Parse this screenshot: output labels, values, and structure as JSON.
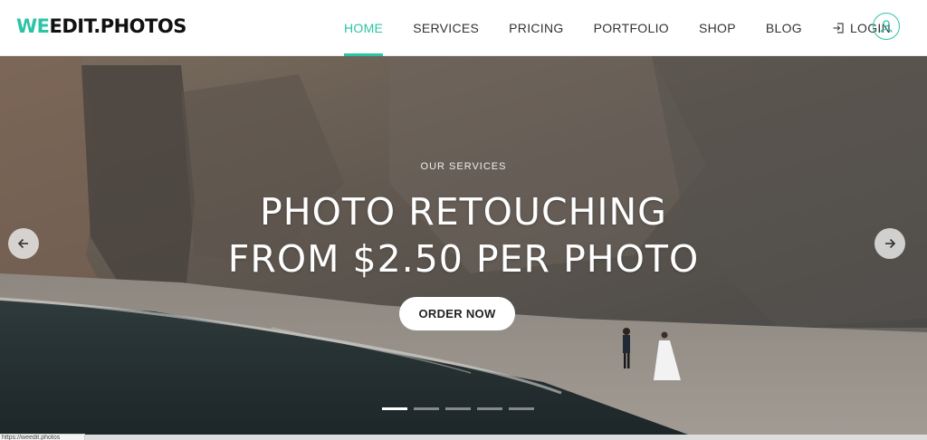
{
  "brand": {
    "prefix": "WE",
    "mid": "EDIT.PHOTOS",
    "accent_color": "#2bc4a4"
  },
  "nav": {
    "items": [
      {
        "label": "HOME",
        "active": true
      },
      {
        "label": "SERVICES"
      },
      {
        "label": "PRICING"
      },
      {
        "label": "PORTFOLIO"
      },
      {
        "label": "SHOP"
      },
      {
        "label": "BLOG"
      }
    ],
    "login_label": "LOGIN",
    "login_icon": "login-icon",
    "user_icon": "user-icon"
  },
  "hero": {
    "eyebrow": "OUR SERVICES",
    "headline_line1": "PHOTO RETOUCHING",
    "headline_line2": "FROM $2.50 PER PHOTO",
    "cta_label": "ORDER NOW",
    "prev_icon": "arrow-left-icon",
    "next_icon": "arrow-right-icon",
    "slides_count": 5,
    "active_slide": 1
  },
  "status_url": "https://weedit.photos"
}
